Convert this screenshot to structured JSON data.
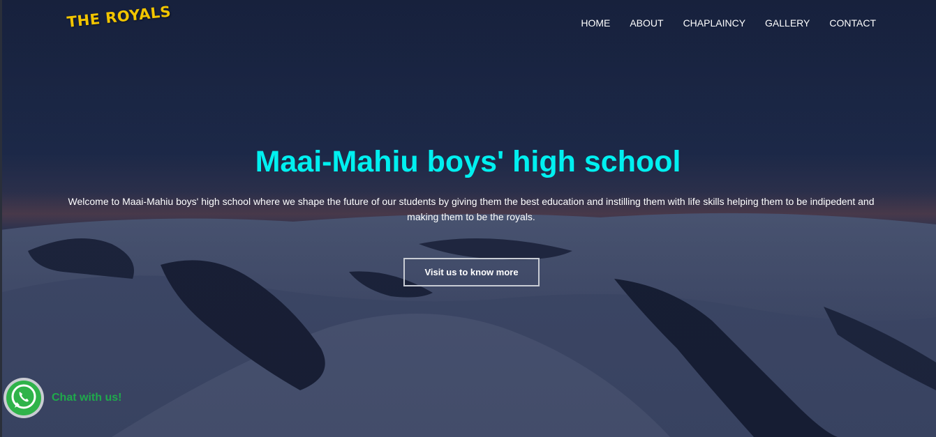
{
  "brand": {
    "logo_text": "THE ROYALS",
    "logo_color": "#f2c500"
  },
  "nav": {
    "items": [
      {
        "label": "HOME"
      },
      {
        "label": "ABOUT"
      },
      {
        "label": "CHAPLAINCY"
      },
      {
        "label": "GALLERY"
      },
      {
        "label": "CONTACT"
      }
    ]
  },
  "hero": {
    "title": "Maai-Mahiu boys' high school",
    "title_color": "#00f0f0",
    "description": "Welcome to Maai-Mahiu boys' high school where we shape the future of our students by giving them the best education and instilling them with life skills helping them to be indipedent and making them to be the royals.",
    "cta_label": "Visit us to know more",
    "background": "snowy-mountain-landscape-at-dusk"
  },
  "chat": {
    "icon": "whatsapp-icon",
    "label": "Chat with us!",
    "color": "#1faa4b"
  }
}
